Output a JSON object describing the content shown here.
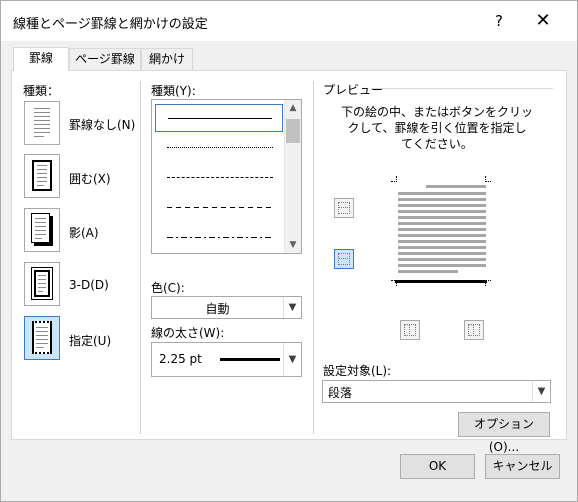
{
  "window": {
    "title": "線種とページ罫線と網かけの設定",
    "help_label": "?",
    "close_label": "✕"
  },
  "tabs": [
    {
      "label": "罫線",
      "active": true
    },
    {
      "label": "ページ罫線",
      "active": false
    },
    {
      "label": "網かけ",
      "active": false
    }
  ],
  "settings": {
    "header": "種類：",
    "items": [
      {
        "label": "罫線なし(N)",
        "icon": "no-border-icon",
        "selected": false
      },
      {
        "label": "囲む(X)",
        "icon": "box-border-icon",
        "selected": false
      },
      {
        "label": "影(A)",
        "icon": "shadow-border-icon",
        "selected": false
      },
      {
        "label": "3-D(D)",
        "icon": "3d-border-icon",
        "selected": false
      },
      {
        "label": "指定(U)",
        "icon": "custom-border-icon",
        "selected": true
      }
    ]
  },
  "style": {
    "header": "種類(Y):",
    "items": [
      "solid",
      "dotted",
      "dashed-fine",
      "dashed",
      "dash-dot"
    ],
    "selected_index": 0
  },
  "color": {
    "label": "色(C):",
    "value": "自動"
  },
  "width": {
    "label": "線の太さ(W):",
    "value": "2.25 pt"
  },
  "preview": {
    "header": "プレビュー",
    "instruction_1": "下の絵の中、またはボタンをクリッ",
    "instruction_2": "クして、罫線を引く位置を指定し",
    "instruction_3": "てください。",
    "bottom_border_set": true
  },
  "apply_to": {
    "label": "設定対象(L):",
    "value": "段落"
  },
  "buttons": {
    "options": "オプション(O)...",
    "ok": "OK",
    "cancel": "キャンセル"
  },
  "colors": {
    "accent": "#3d7cc4",
    "selected_fill": "#cce4f7"
  }
}
